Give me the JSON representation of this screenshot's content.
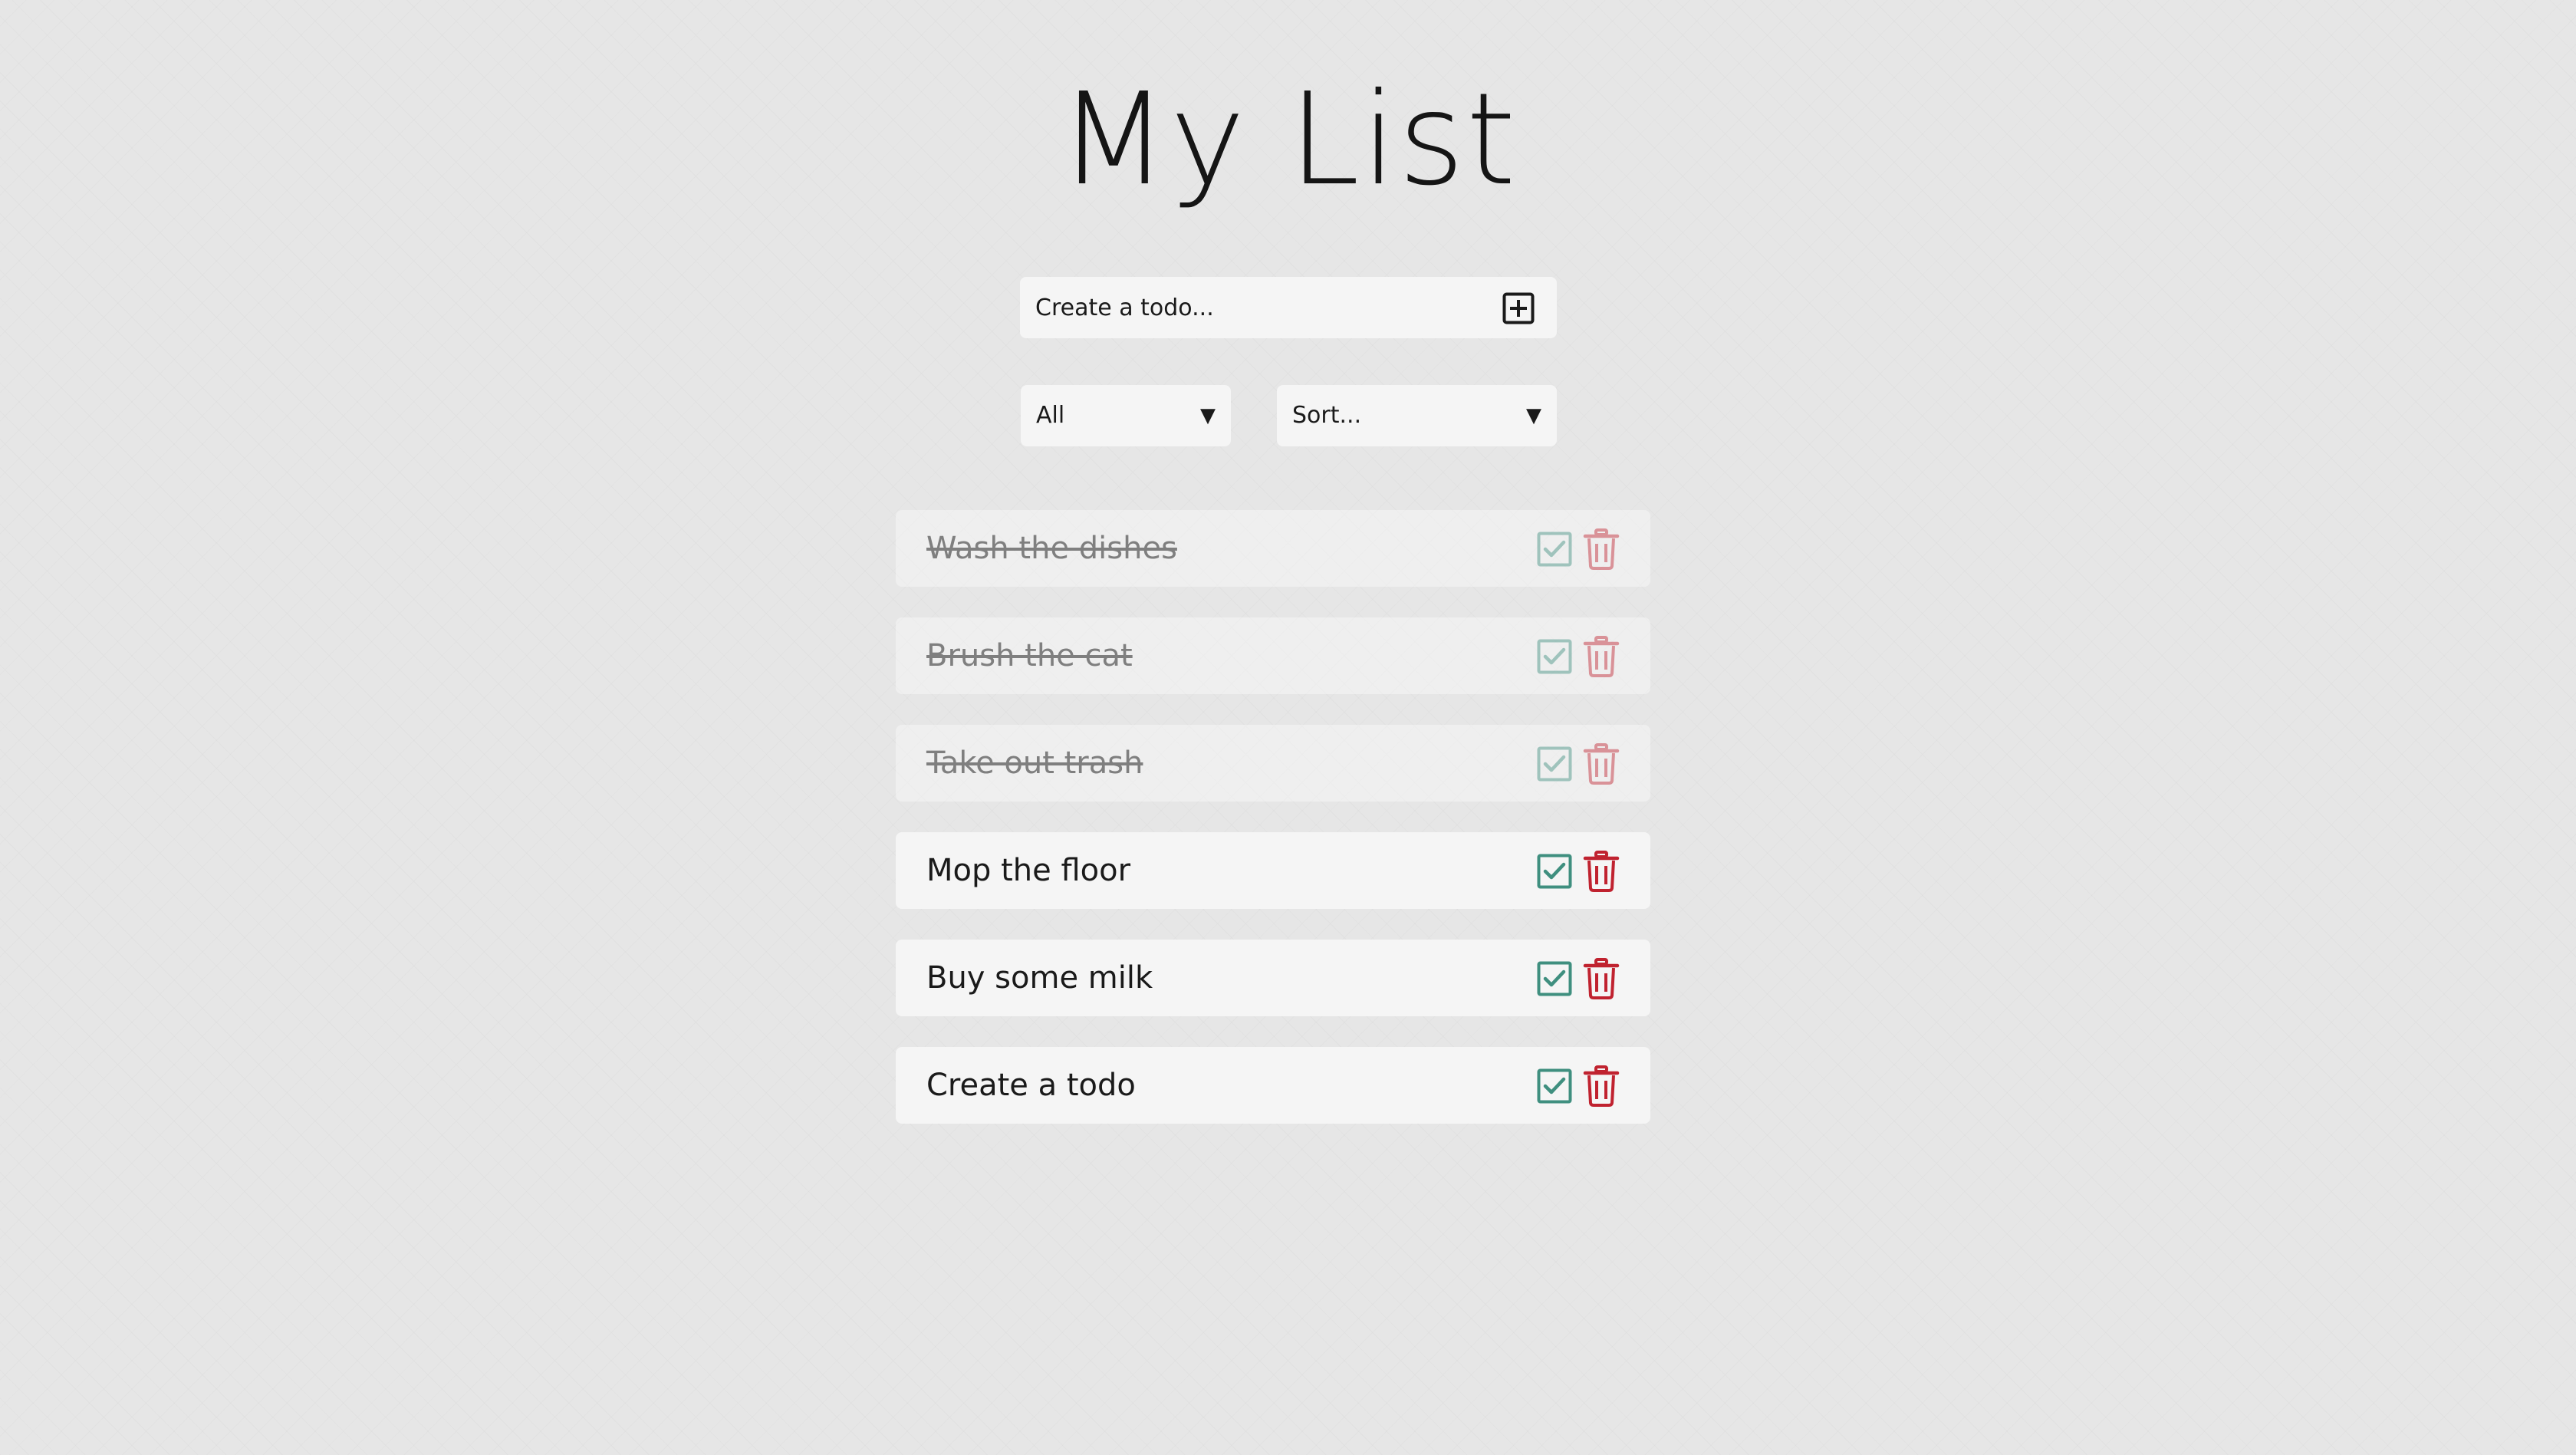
{
  "page": {
    "title": "My List"
  },
  "create": {
    "placeholder": "Create a todo...",
    "add_icon": "plus-square-icon"
  },
  "filters": {
    "status_select": {
      "selected": "All",
      "arrow": "▼"
    },
    "sort_select": {
      "selected": "Sort...",
      "arrow": "▼"
    }
  },
  "todos": [
    {
      "text": "Wash the dishes",
      "completed": true
    },
    {
      "text": "Brush the cat",
      "completed": true
    },
    {
      "text": "Take out trash",
      "completed": true
    },
    {
      "text": "Mop the floor",
      "completed": false
    },
    {
      "text": "Buy some milk",
      "completed": false
    },
    {
      "text": "Create a todo",
      "completed": false
    }
  ],
  "icons": {
    "complete": "check-square-icon",
    "delete": "trash-icon"
  },
  "colors": {
    "check": "#3f8f7f",
    "trash": "#c0222f",
    "item_background": "#f5f5f5",
    "text": "#1a1a1a",
    "completed_text": "#7f7f7f"
  }
}
